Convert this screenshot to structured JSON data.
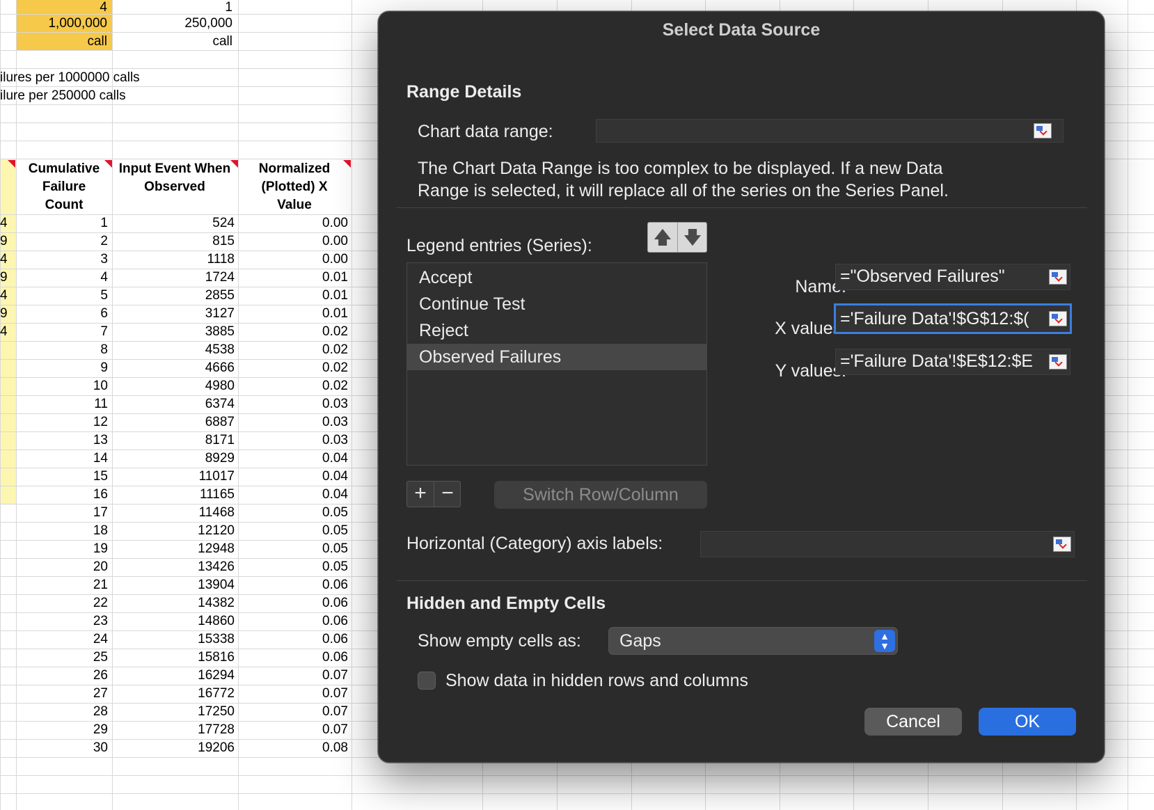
{
  "sheet": {
    "top_cells": {
      "r1": [
        "4",
        "1"
      ],
      "r2": [
        "1,000,000",
        "250,000"
      ],
      "r3": [
        "call",
        "call"
      ]
    },
    "notes": [
      "ilures per 1000000 calls",
      "ilure per 250000 calls"
    ],
    "headers": {
      "cumulative": [
        "Cumulative",
        "Failure",
        "Count"
      ],
      "input": [
        "Input Event When",
        "Observed"
      ],
      "normalized": [
        "Normalized",
        "(Plotted) X",
        "Value"
      ]
    },
    "left_partial": [
      "4",
      "9",
      "4",
      "9",
      "4",
      "9",
      "4"
    ],
    "rows": [
      [
        "1",
        "524",
        "0.00"
      ],
      [
        "2",
        "815",
        "0.00"
      ],
      [
        "3",
        "1118",
        "0.00"
      ],
      [
        "4",
        "1724",
        "0.01"
      ],
      [
        "5",
        "2855",
        "0.01"
      ],
      [
        "6",
        "3127",
        "0.01"
      ],
      [
        "7",
        "3885",
        "0.02"
      ],
      [
        "8",
        "4538",
        "0.02"
      ],
      [
        "9",
        "4666",
        "0.02"
      ],
      [
        "10",
        "4980",
        "0.02"
      ],
      [
        "11",
        "6374",
        "0.03"
      ],
      [
        "12",
        "6887",
        "0.03"
      ],
      [
        "13",
        "8171",
        "0.03"
      ],
      [
        "14",
        "8929",
        "0.04"
      ],
      [
        "15",
        "11017",
        "0.04"
      ],
      [
        "16",
        "11165",
        "0.04"
      ],
      [
        "17",
        "11468",
        "0.05"
      ],
      [
        "18",
        "12120",
        "0.05"
      ],
      [
        "19",
        "12948",
        "0.05"
      ],
      [
        "20",
        "13426",
        "0.05"
      ],
      [
        "21",
        "13904",
        "0.06"
      ],
      [
        "22",
        "14382",
        "0.06"
      ],
      [
        "23",
        "14860",
        "0.06"
      ],
      [
        "24",
        "15338",
        "0.06"
      ],
      [
        "25",
        "15816",
        "0.06"
      ],
      [
        "26",
        "16294",
        "0.07"
      ],
      [
        "27",
        "16772",
        "0.07"
      ],
      [
        "28",
        "17250",
        "0.07"
      ],
      [
        "29",
        "17728",
        "0.07"
      ],
      [
        "30",
        "19206",
        "0.08"
      ]
    ],
    "colors": {
      "orange_fill": "#f6c94a",
      "yellow_fill": "#fdf6b0",
      "grid": "#d8d8d8"
    }
  },
  "dialog": {
    "title": "Select Data Source",
    "range_details": {
      "heading": "Range Details",
      "chart_range_label": "Chart data range:",
      "chart_range_value": "",
      "message_line1": "The Chart Data Range is too complex to be displayed. If a new Data",
      "message_line2": "Range is selected, it will replace all of the series on the Series Panel."
    },
    "series": {
      "label": "Legend entries (Series):",
      "items": [
        "Accept",
        "Continue Test",
        "Reject",
        "Observed Failures"
      ],
      "selected_index": 3,
      "add_symbol": "+",
      "remove_symbol": "−",
      "switch_label": "Switch Row/Column",
      "up_icon": "arrow-up-icon",
      "down_icon": "arrow-down-icon"
    },
    "fields": {
      "name_label": "Name:",
      "name_value": "=\"Observed Failures\"",
      "x_label": "X values:",
      "x_value": "='Failure Data'!$G$12:$(",
      "y_label": "Y values:",
      "y_value": "='Failure Data'!$E$12:$E"
    },
    "axis_labels": {
      "label": "Horizontal (Category) axis labels:",
      "value": ""
    },
    "hidden_empty": {
      "heading": "Hidden and Empty Cells",
      "show_empty_label": "Show empty cells as:",
      "show_empty_value": "Gaps",
      "checkbox_label": "Show data in hidden rows and columns",
      "checkbox_checked": false
    },
    "buttons": {
      "cancel": "Cancel",
      "ok": "OK"
    },
    "colors": {
      "accent": "#2a6fe0",
      "background": "#2b2b2b"
    }
  }
}
